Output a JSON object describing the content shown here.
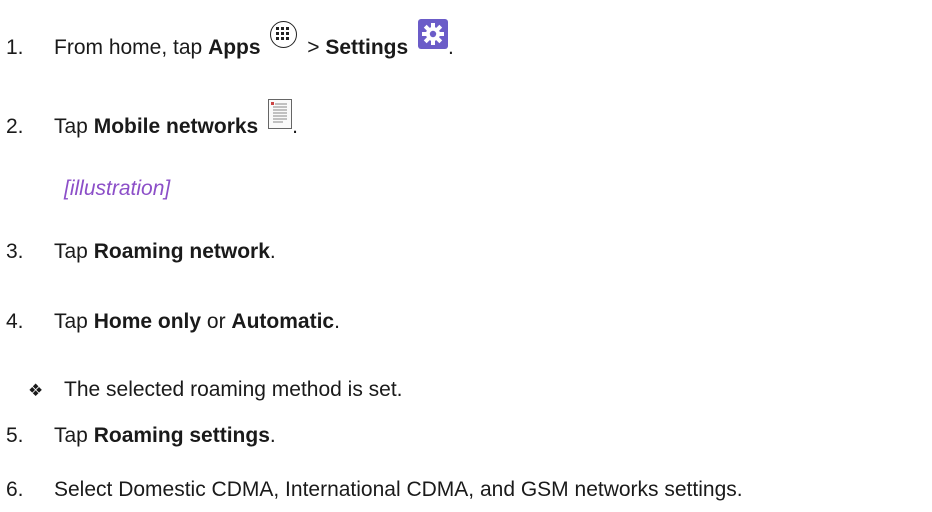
{
  "steps": [
    {
      "num": "1.",
      "pre": "From home, tap ",
      "b1": "Apps",
      "sep": " > ",
      "b2": "Settings",
      "post": ".",
      "icons": [
        "apps-icon",
        "settings-icon"
      ]
    },
    {
      "num": "2.",
      "pre": "Tap ",
      "b1": "Mobile networks",
      "post": ".",
      "icons": [
        "mobile-networks-icon"
      ]
    },
    {
      "num": "3.",
      "pre": "Tap ",
      "b1": "Roaming network",
      "post": "."
    },
    {
      "num": "4.",
      "pre": "Tap ",
      "b1": "Home only",
      "mid": " or ",
      "b2": "Automatic",
      "post": "."
    },
    {
      "num": "5.",
      "pre": "Tap ",
      "b1": "Roaming settings",
      "post": "."
    },
    {
      "num": "6.",
      "text": "Select Domestic CDMA, International CDMA, and GSM networks settings."
    }
  ],
  "illustration": "[illustration]",
  "bullet": {
    "glyph": "❖",
    "text": "The selected roaming method is set."
  },
  "colors": {
    "illustration_text": "#8c4fc8",
    "settings_icon_bg": "#6b5cc8"
  }
}
